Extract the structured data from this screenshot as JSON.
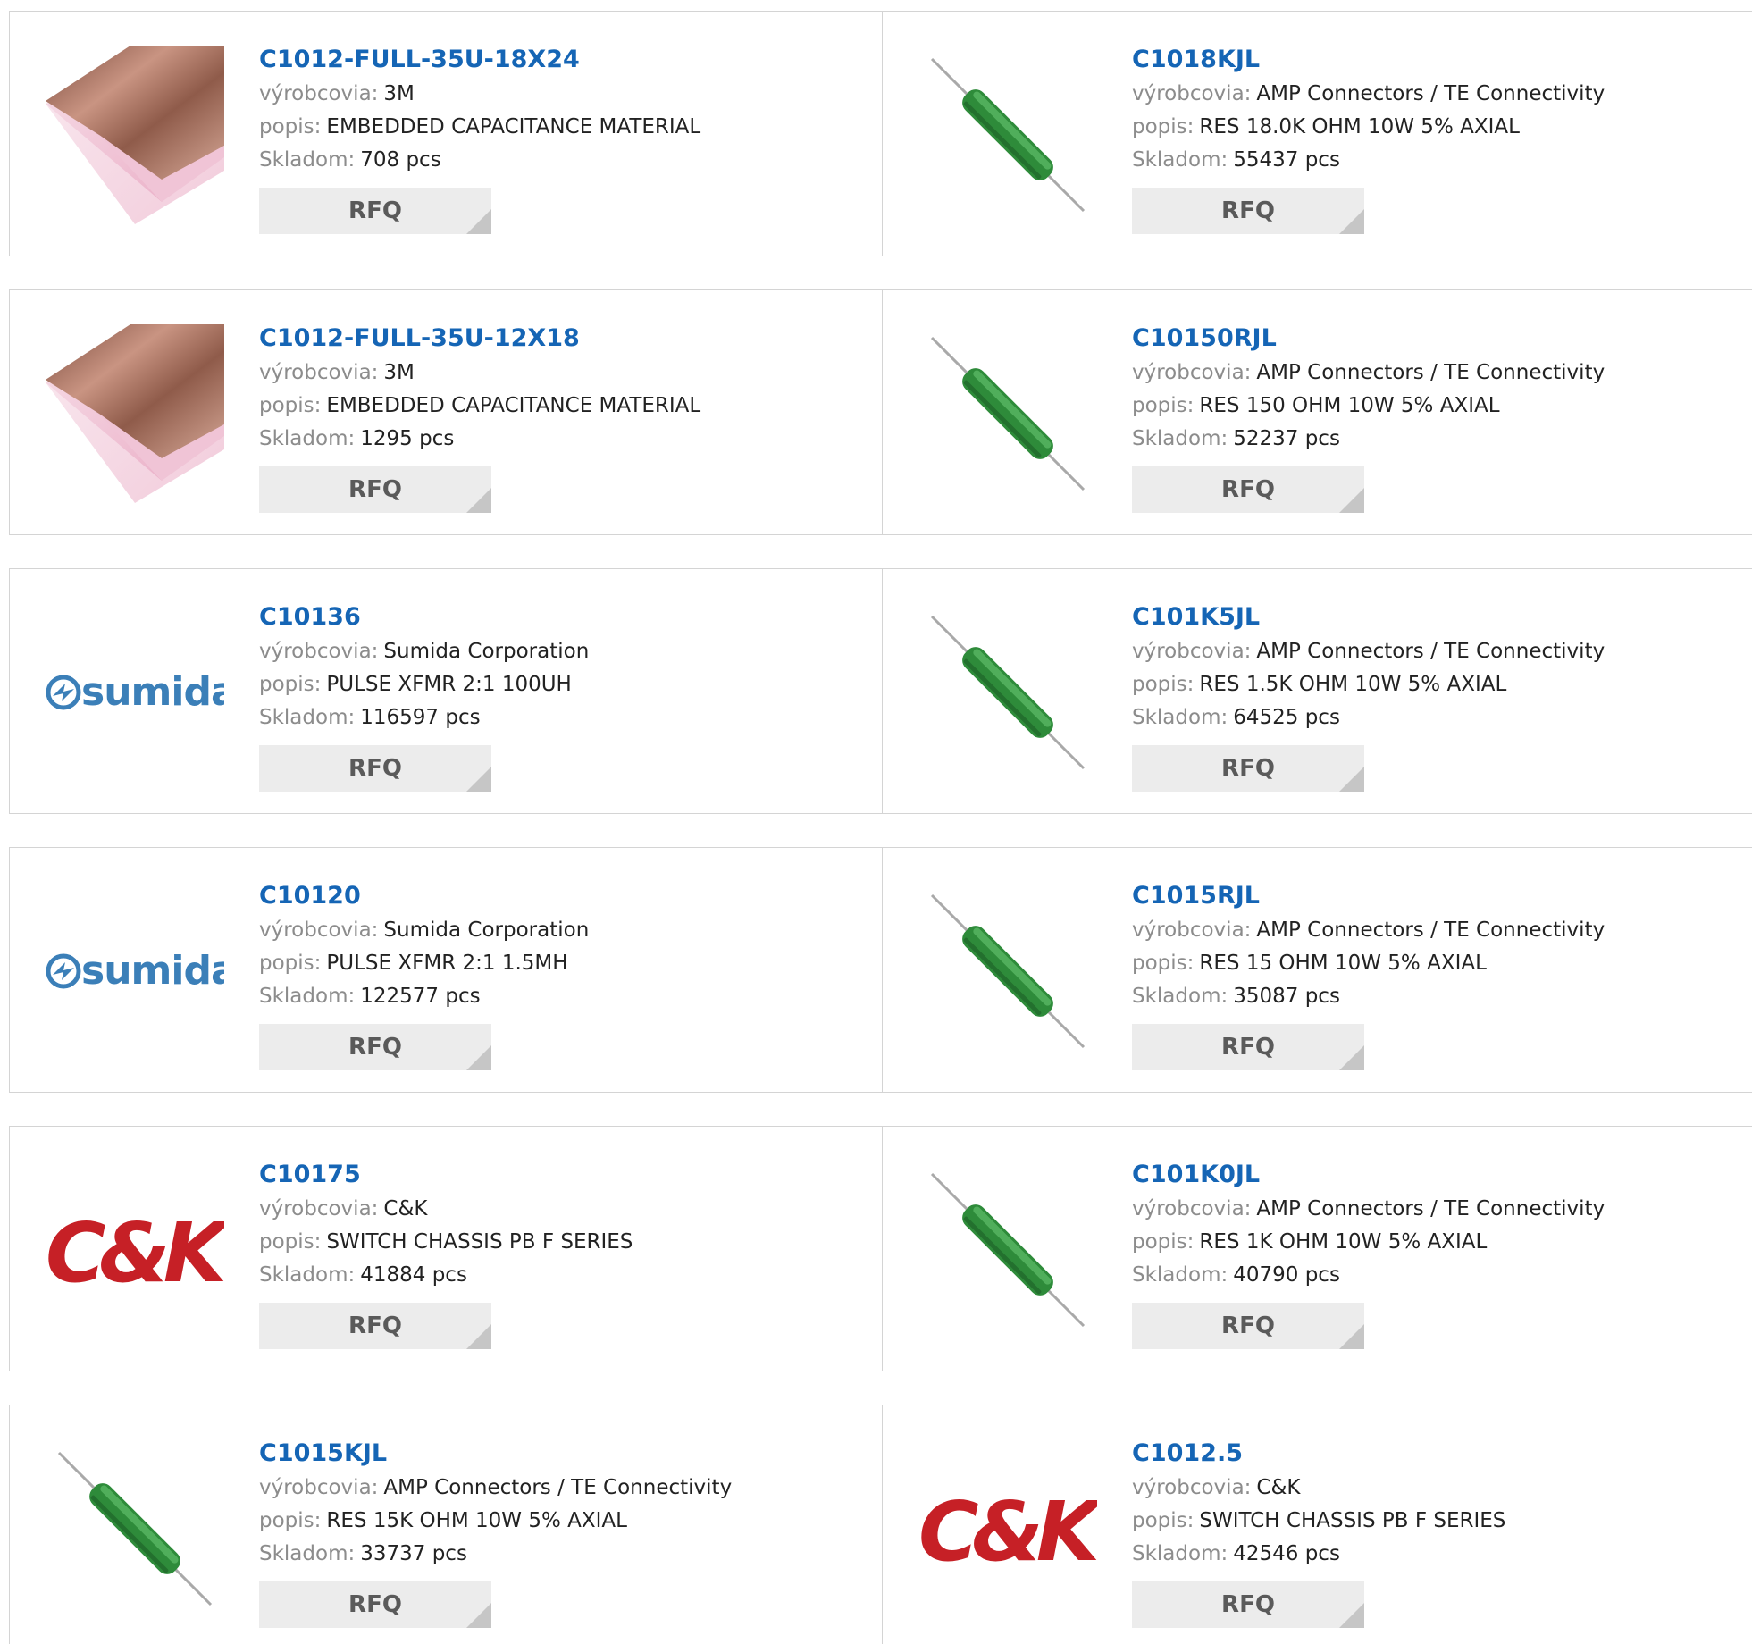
{
  "labels": {
    "manufacturer": "výrobcovia:",
    "description": "popis:",
    "stock": "Skladom:",
    "rfq": "RFQ"
  },
  "brand_text": {
    "sumida": "sumida",
    "ck": "C&K"
  },
  "colors": {
    "link": "#1565b5",
    "label": "#8c8c8c",
    "rfq_bg": "#ececec",
    "ck_red": "#c62026",
    "sumida_blue": "#3b7fb8",
    "resistor_green": "#2e8b3a"
  },
  "products": [
    {
      "pn": "C1012-FULL-35U-18X24",
      "manufacturer": "3M",
      "description": "EMBEDDED CAPACITANCE MATERIAL",
      "stock": "708 pcs",
      "image": "copper-laminate-icon"
    },
    {
      "pn": "C1018KJL",
      "manufacturer": "AMP Connectors / TE Connectivity",
      "description": "RES 18.0K OHM 10W 5% AXIAL",
      "stock": "55437 pcs",
      "image": "resistor-icon"
    },
    {
      "pn": "C1012-FULL-35U-12X18",
      "manufacturer": "3M",
      "description": "EMBEDDED CAPACITANCE MATERIAL",
      "stock": "1295 pcs",
      "image": "copper-laminate-icon"
    },
    {
      "pn": "C10150RJL",
      "manufacturer": "AMP Connectors / TE Connectivity",
      "description": "RES 150 OHM 10W 5% AXIAL",
      "stock": "52237 pcs",
      "image": "resistor-icon"
    },
    {
      "pn": "C10136",
      "manufacturer": "Sumida Corporation",
      "description": "PULSE XFMR 2:1 100UH",
      "stock": "116597 pcs",
      "image": "sumida-logo"
    },
    {
      "pn": "C101K5JL",
      "manufacturer": "AMP Connectors / TE Connectivity",
      "description": "RES 1.5K OHM 10W 5% AXIAL",
      "stock": "64525 pcs",
      "image": "resistor-icon"
    },
    {
      "pn": "C10120",
      "manufacturer": "Sumida Corporation",
      "description": "PULSE XFMR 2:1 1.5MH",
      "stock": "122577 pcs",
      "image": "sumida-logo"
    },
    {
      "pn": "C1015RJL",
      "manufacturer": "AMP Connectors / TE Connectivity",
      "description": "RES 15 OHM 10W 5% AXIAL",
      "stock": "35087 pcs",
      "image": "resistor-icon"
    },
    {
      "pn": "C10175",
      "manufacturer": "C&K",
      "description": "SWITCH CHASSIS PB F SERIES",
      "stock": "41884 pcs",
      "image": "ck-logo"
    },
    {
      "pn": "C101K0JL",
      "manufacturer": "AMP Connectors / TE Connectivity",
      "description": "RES 1K OHM 10W 5% AXIAL",
      "stock": "40790 pcs",
      "image": "resistor-icon"
    },
    {
      "pn": "C1015KJL",
      "manufacturer": "AMP Connectors / TE Connectivity",
      "description": "RES 15K OHM 10W 5% AXIAL",
      "stock": "33737 pcs",
      "image": "resistor-icon"
    },
    {
      "pn": "C1012.5",
      "manufacturer": "C&K",
      "description": "SWITCH CHASSIS PB F SERIES",
      "stock": "42546 pcs",
      "image": "ck-logo"
    }
  ]
}
